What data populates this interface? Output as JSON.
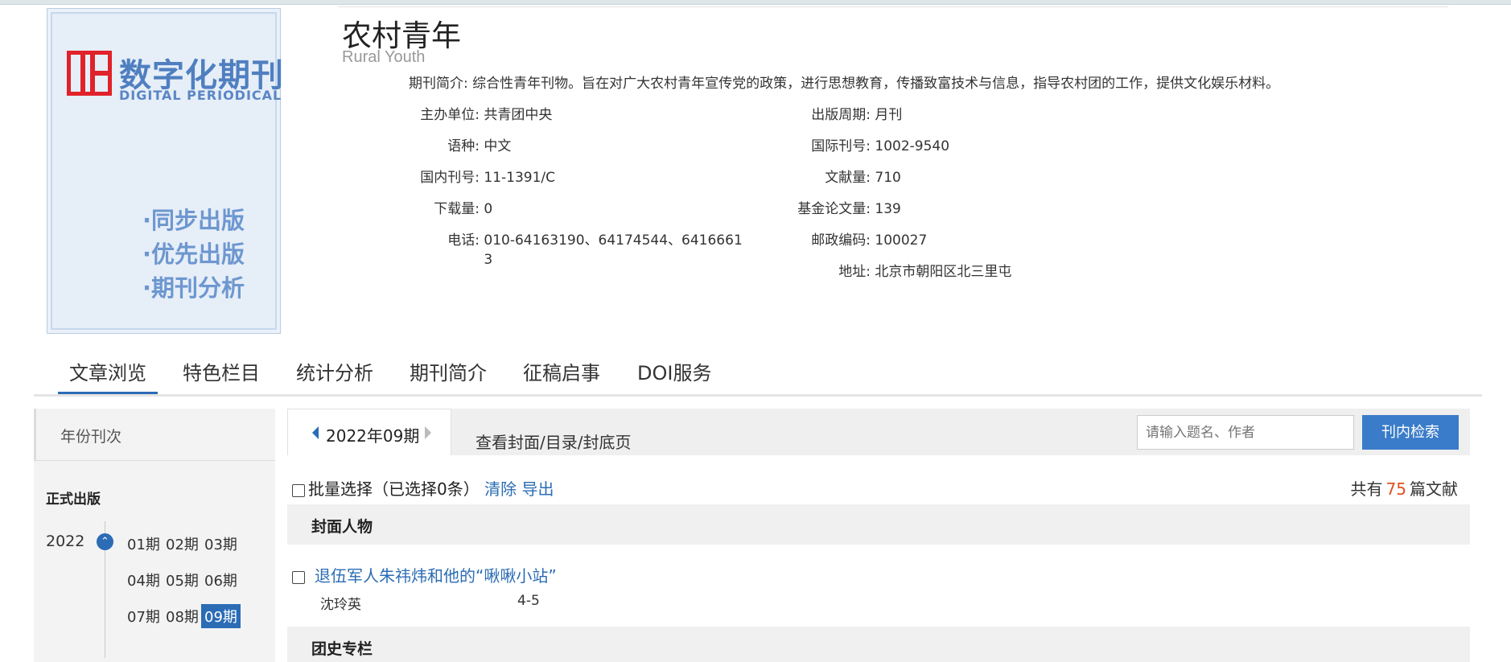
{
  "cover": {
    "logo_cn": "数字化期刊",
    "logo_en": "DIGITAL PERIODICAL",
    "bullets": [
      "·同步出版",
      "·优先出版",
      "·期刊分析"
    ]
  },
  "journal": {
    "title": "农村青年",
    "subtitle": "Rural Youth",
    "intro_label": "期刊简介:",
    "intro_value": "综合性青年刊物。旨在对广大农村青年宣传党的政策，进行思想教育，传播致富技术与信息，指导农村团的工作，提供文化娱乐材料。",
    "left": [
      {
        "label": "主办单位:",
        "value": "共青团中央"
      },
      {
        "label": "语种:",
        "value": "中文"
      },
      {
        "label": "国内刊号:",
        "value": "11-1391/C"
      },
      {
        "label": "下载量:",
        "value": "0"
      },
      {
        "label": "电话:",
        "value": "010-64163190、64174544、6416661",
        "value2": "3"
      }
    ],
    "right": [
      {
        "label": "出版周期:",
        "value": "月刊"
      },
      {
        "label": "国际刊号:",
        "value": "1002-9540"
      },
      {
        "label": "文献量:",
        "value": "710"
      },
      {
        "label": "基金论文量:",
        "value": "139"
      },
      {
        "label": "邮政编码:",
        "value": "100027"
      },
      {
        "label": "地址:",
        "value": "北京市朝阳区北三里屯"
      }
    ]
  },
  "tabs": [
    "文章浏览",
    "特色栏目",
    "统计分析",
    "期刊简介",
    "征稿启事",
    "DOI服务"
  ],
  "sidebar": {
    "header": "年份刊次",
    "section": "正式出版",
    "year": "2022",
    "issues": [
      "01期",
      "02期",
      "03期",
      "04期",
      "05期",
      "06期",
      "07期",
      "08期",
      "09期"
    ],
    "selected_issue": "09期"
  },
  "toolbar": {
    "current_issue": "2022年09期",
    "cover_link": "查看封面/目录/封底页",
    "search_placeholder": "请输入题名、作者",
    "search_button": "刊内检索"
  },
  "list": {
    "batch_label": "批量选择（已选择0条）",
    "clear": "清除",
    "export": "导出",
    "total_prefix": "共有",
    "total_count": "75",
    "total_suffix": "篇文献",
    "sections": [
      {
        "name": "封面人物"
      },
      {
        "name": "团史专栏"
      }
    ],
    "article": {
      "title": "退伍军人朱祎炜和他的“啾啾小站”",
      "author": "沈玲英",
      "pages": "4-5"
    }
  },
  "colors": {
    "accent": "#2b6cb5",
    "count": "#e05020",
    "logo_red": "#e0222a"
  }
}
